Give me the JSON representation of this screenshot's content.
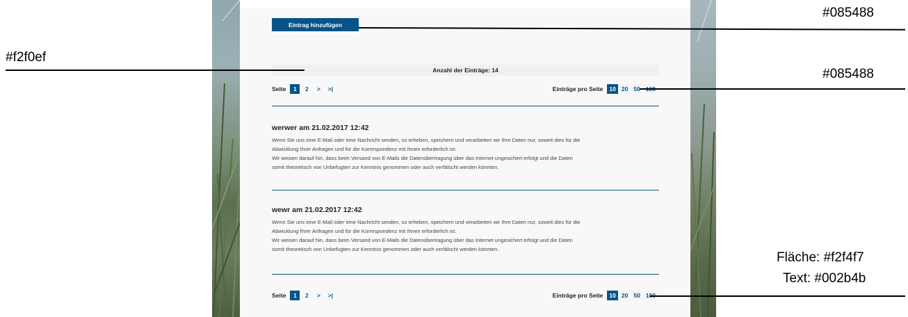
{
  "add_button": {
    "label": "Eintrag hinzufügen"
  },
  "count_bar": {
    "text": "Anzahl der Einträge: 14"
  },
  "pager": {
    "page_label": "Seite",
    "pages": [
      "1",
      "2"
    ],
    "next": ">",
    "last": ">|",
    "per_page_label": "Einträge pro Seite",
    "per_page_options": [
      "10",
      "20",
      "50",
      "100"
    ],
    "active_page": "1",
    "active_per_page": "10"
  },
  "entries": [
    {
      "title": "werwer am 21.02.2017 12:42",
      "lines": [
        "Wenn Sie uns eine E-Mail oder eine Nachricht senden, so erheben, speichern und verarbeiten wir Ihre Daten nur, soweit dies für die",
        "Abwicklung Ihrer Anfragen und für die Korrespondenz mit Ihnen erforderlich ist.",
        "Wir weisen darauf hin, dass beim Versand von E-Mails die Datenübertragung über das Internet ungesichert erfolgt und die Daten",
        "somit theoretisch von Unbefugten zur Kenntnis genommen oder auch verfälscht werden könnten."
      ]
    },
    {
      "title": "wewr am 21.02.2017 12:42",
      "lines": [
        "Wenn Sie uns eine E-Mail oder eine Nachricht senden, so erheben, speichern und verarbeiten wir Ihre Daten nur, soweit dies für die",
        "Abwicklung Ihrer Anfragen und für die Korrespondenz mit Ihnen erforderlich ist.",
        "Wir weisen darauf hin, dass beim Versand von E-Mails die Datenübertragung über das Internet ungesichert erfolgt und die Daten",
        "somit theoretisch von Unbefugten zur Kenntnis genommen oder auch verfälscht werden könnten."
      ]
    }
  ],
  "annotations": {
    "button_color": "#085488",
    "bar_color": "#f2f0ef",
    "pager_color": "#085488",
    "surface_line": "Fläche: #f2f4f7",
    "text_line": "Text: #002b4b"
  },
  "colors": {
    "accent": "#085488",
    "bar": "#f2f0ef",
    "pager_surface": "#f2f4f7",
    "pager_text": "#002b4b"
  }
}
